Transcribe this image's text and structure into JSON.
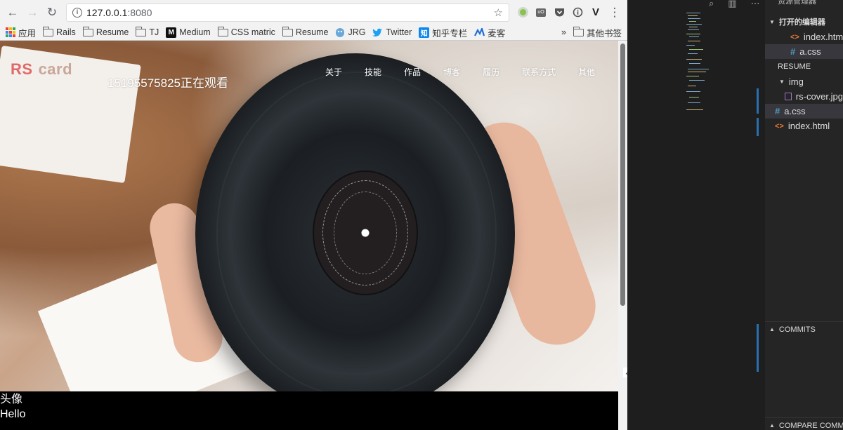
{
  "browser": {
    "url_host": "127.0.0.1",
    "url_port": ":8080",
    "back_icon": "←",
    "forward_icon": "→",
    "reload_icon": "↻",
    "star_icon": "☆",
    "menu_icon": "⋮",
    "ext_ublock": "uO",
    "ext_v": "V",
    "ext_info": "i"
  },
  "bookmarks": {
    "items": [
      {
        "label": "应用",
        "icon": "apps-icon"
      },
      {
        "label": "Rails",
        "icon": "folder-icon"
      },
      {
        "label": "Resume",
        "icon": "folder-icon"
      },
      {
        "label": "TJ",
        "icon": "folder-icon"
      },
      {
        "label": "Medium",
        "icon": "medium-icon",
        "glyph": "M"
      },
      {
        "label": "CSS matric",
        "icon": "folder-icon"
      },
      {
        "label": "Resume",
        "icon": "folder-icon"
      },
      {
        "label": "JRG",
        "icon": "jrg-icon"
      },
      {
        "label": "Twitter",
        "icon": "twitter-icon"
      },
      {
        "label": "知乎专栏",
        "icon": "zhihu-icon",
        "glyph": "知"
      },
      {
        "label": "麦客",
        "icon": "maike-icon"
      }
    ],
    "overflow": "»",
    "other": "其他书签"
  },
  "site": {
    "logo_rs": "RS",
    "logo_card": "card",
    "viewer_text": "15195575825正在观看",
    "nav": [
      "关于",
      "技能",
      "作品",
      "博客",
      "履历",
      "联系方式",
      "其他"
    ],
    "avatar_label": "头像",
    "hello": "Hello"
  },
  "editor": {
    "explorer_title": "资源管理器",
    "open_editors": "打开的编辑器",
    "open_files": [
      {
        "name": "index.html",
        "type": "html"
      },
      {
        "name": "a.css",
        "type": "css"
      }
    ],
    "project": "RESUME",
    "tree": [
      {
        "name": "img",
        "type": "folder"
      },
      {
        "name": "rs-cover.jpg",
        "type": "image"
      },
      {
        "name": "a.css",
        "type": "css"
      },
      {
        "name": "index.html",
        "type": "html"
      }
    ],
    "commits": "COMMITS",
    "compare_commits": "COMPARE COMMITS",
    "html_glyph": "<>",
    "css_glyph": "#"
  },
  "colors": {
    "logo_rs": "#e06a6a",
    "logo_card": "#c9a79a",
    "editor_bg": "#1e1e1e",
    "explorer_bg": "#252526",
    "git_marker": "#2a6fb0"
  }
}
